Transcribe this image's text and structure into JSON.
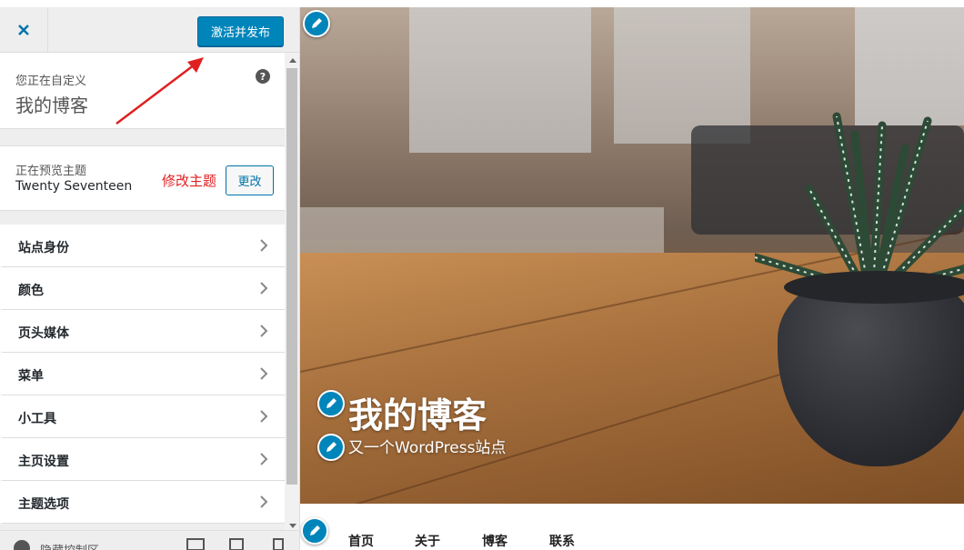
{
  "header": {
    "publish_label": "激活并发布"
  },
  "customizing": {
    "subtitle": "您正在自定义",
    "site_name": "我的博客"
  },
  "theme": {
    "previewing_label": "正在预览主题",
    "name": "Twenty Seventeen",
    "annotation": "修改主题",
    "change_label": "更改"
  },
  "sections": [
    {
      "label": "站点身份"
    },
    {
      "label": "颜色"
    },
    {
      "label": "页头媒体"
    },
    {
      "label": "菜单"
    },
    {
      "label": "小工具"
    },
    {
      "label": "主页设置"
    },
    {
      "label": "主题选项"
    }
  ],
  "footer": {
    "hide_controls_label": "隐藏控制区"
  },
  "preview": {
    "site_title": "我的博客",
    "site_description": "又一个WordPress站点",
    "nav": [
      "首页",
      "关于",
      "博客",
      "联系"
    ]
  },
  "colors": {
    "accent": "#0085ba",
    "annotation": "#e02020"
  },
  "icons": {
    "close": "close-icon",
    "help": "help-icon",
    "chevron": "chevron-right-icon",
    "edit": "pencil-icon"
  }
}
